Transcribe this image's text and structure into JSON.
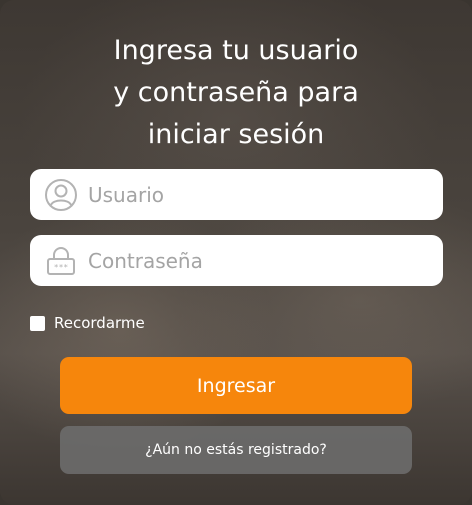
{
  "login": {
    "title_lines": [
      "Ingresa tu usuario",
      "y contraseña para",
      "iniciar sesión"
    ],
    "username_placeholder": "Usuario",
    "password_placeholder": "Contraseña",
    "remember_label": "Recordarme",
    "submit_label": "Ingresar",
    "register_label": "¿Aún no estás registrado?"
  },
  "colors": {
    "primary_button": "#f6860c",
    "secondary_button": "#6e6e6e",
    "field_background": "#ffffff"
  },
  "icons": {
    "username": "user-circle-icon",
    "password": "padlock-icon"
  }
}
